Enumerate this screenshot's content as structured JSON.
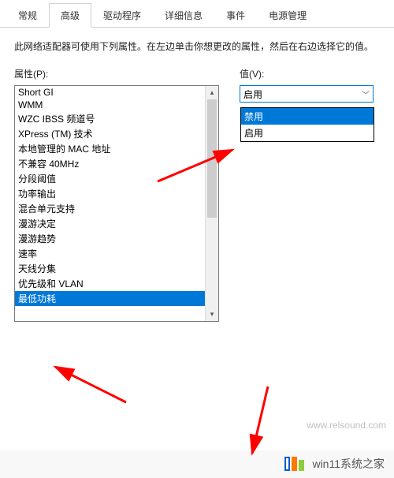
{
  "tabs": {
    "items": [
      {
        "label": "常规",
        "active": false
      },
      {
        "label": "高级",
        "active": true
      },
      {
        "label": "驱动程序",
        "active": false
      },
      {
        "label": "详细信息",
        "active": false
      },
      {
        "label": "事件",
        "active": false
      },
      {
        "label": "电源管理",
        "active": false
      }
    ]
  },
  "panel": {
    "description": "此网络适配器可使用下列属性。在左边单击你想更改的属性，然后在右边选择它的值。",
    "props_label": "属性(P):",
    "value_label": "值(V):"
  },
  "properties": {
    "items": [
      "Short GI",
      "WMM",
      "WZC IBSS 频道号",
      "XPress (TM) 技术",
      "本地管理的 MAC 地址",
      "不兼容 40MHz",
      "分段阈值",
      "功率输出",
      "混合单元支持",
      "漫游决定",
      "漫游趋势",
      "速率",
      "天线分集",
      "优先级和 VLAN",
      "最低功耗"
    ],
    "selected_index": 14
  },
  "value": {
    "selected": "启用",
    "options": [
      "禁用",
      "启用"
    ],
    "highlight_index": 0
  },
  "watermark": "www.relsound.com",
  "footer": {
    "brand": "win11系统之家"
  }
}
